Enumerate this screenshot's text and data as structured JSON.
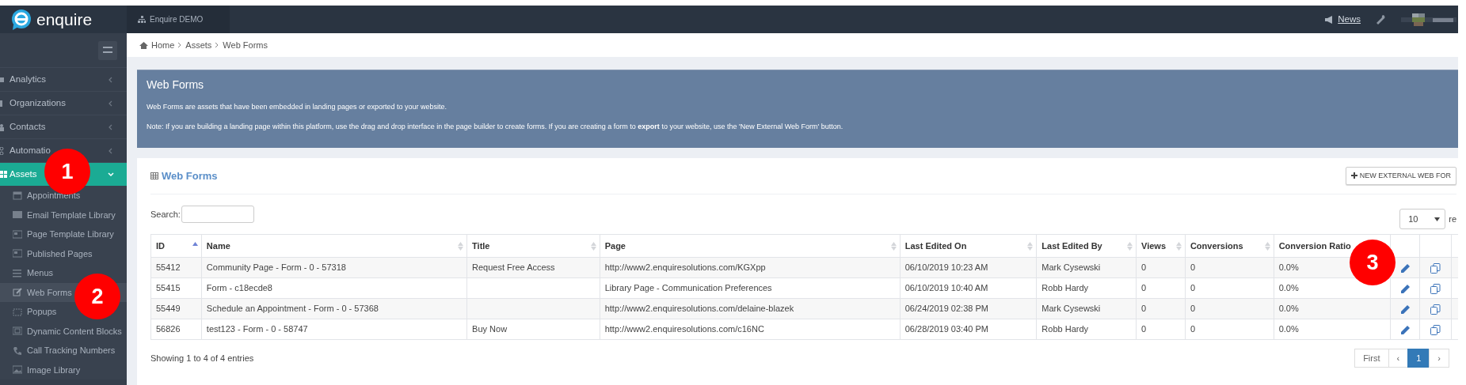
{
  "top_bar": {
    "logo_text": "enquire",
    "account": "Enquire DEMO",
    "news": "News"
  },
  "sidebar": {
    "items": [
      {
        "label": "Analytics",
        "expanded": false,
        "selected": false
      },
      {
        "label": "Organizations",
        "expanded": false,
        "selected": false
      },
      {
        "label": "Contacts",
        "expanded": false,
        "selected": false
      },
      {
        "label": "Automatio",
        "expanded": false,
        "selected": false
      },
      {
        "label": "Assets",
        "expanded": true,
        "selected": true,
        "children": [
          {
            "label": "Appointments",
            "selected": false
          },
          {
            "label": "Email Template Library",
            "selected": false
          },
          {
            "label": "Page Template Library",
            "selected": false
          },
          {
            "label": "Published Pages",
            "selected": false
          },
          {
            "label": "Menus",
            "selected": false
          },
          {
            "label": "Web Forms",
            "selected": true
          },
          {
            "label": "Popups",
            "selected": false
          },
          {
            "label": "Dynamic Content Blocks",
            "selected": false
          },
          {
            "label": "Call Tracking Numbers",
            "selected": false
          },
          {
            "label": "Image Library",
            "selected": false
          }
        ]
      }
    ]
  },
  "breadcrumb": [
    "Home",
    "Assets",
    "Web Forms"
  ],
  "banner": {
    "title": "Web Forms",
    "text": "Web Forms are assets that have been embedded in landing pages or exported to your website.",
    "note": "Note: If you are building a landing page within this platform, use the drag and drop interface in the page builder to create forms. If you are creating a form to **export** to your website, use the 'New External Web Form' button."
  },
  "card": {
    "title": "Web Forms",
    "new_button": "NEW EXTERNAL WEB FOR",
    "search_label": "Search:",
    "page_size": "10",
    "page_size_suffix": "re"
  },
  "table": {
    "columns": [
      {
        "label": "ID",
        "sorted": true
      },
      {
        "label": "Name",
        "sorted": false
      },
      {
        "label": "Title",
        "sorted": false
      },
      {
        "label": "Page",
        "sorted": false
      },
      {
        "label": "Last Edited On",
        "sorted": false
      },
      {
        "label": "Last Edited By",
        "sorted": false
      },
      {
        "label": "Views",
        "sorted": false
      },
      {
        "label": "Conversions",
        "sorted": false
      },
      {
        "label": "Conversion Ratio"
      }
    ],
    "rows": [
      {
        "cells": [
          "55412",
          "Community Page - Form - 0 - 57318",
          "Request Free Access",
          "http://www2.enquiresolutions.com/KGXpp",
          "06/10/2019 10:23 AM",
          "Mark Cysewski",
          "0",
          "0",
          "0.0%"
        ]
      },
      {
        "cells": [
          "55415",
          "Form - c18ecde8",
          "",
          "Library Page - Communication Preferences",
          "06/10/2019 10:40 AM",
          "Robb Hardy",
          "0",
          "0",
          "0.0%"
        ]
      },
      {
        "cells": [
          "55449",
          "Schedule an Appointment - Form - 0 - 57368",
          "",
          "http://www2.enquiresolutions.com/delaine-blazek",
          "06/24/2019 02:38 PM",
          "Mark Cysewski",
          "0",
          "0",
          "0.0%"
        ]
      },
      {
        "cells": [
          "56826",
          "test123 - Form - 0 - 58747",
          "Buy Now",
          "http://www2.enquiresolutions.com/c16NC",
          "06/28/2019 03:40 PM",
          "Robb Hardy",
          "0",
          "0",
          "0.0%"
        ]
      }
    ]
  },
  "footer": {
    "info": "Showing 1 to 4 of 4 entries",
    "pages": [
      {
        "label": "First",
        "selected": false
      },
      {
        "label": "‹",
        "selected": false
      },
      {
        "label": "1",
        "selected": true
      },
      {
        "label": "›",
        "selected": false
      }
    ]
  },
  "annotations": [
    {
      "label": "1"
    },
    {
      "label": "2"
    },
    {
      "label": "3"
    }
  ]
}
